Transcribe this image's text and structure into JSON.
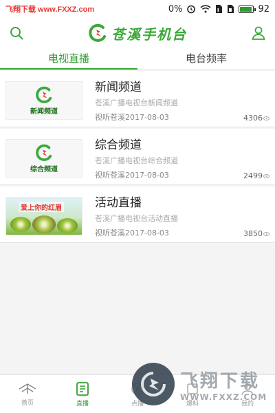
{
  "status_bar": {
    "watermark": "飞翔下载 www.FXXZ.com",
    "signal": "0%",
    "battery": "92",
    "battery_level": 0.92
  },
  "header": {
    "title": "苍溪手机台",
    "left_icon": "search-icon",
    "right_icon": "user-icon"
  },
  "tabs": [
    {
      "label": "电视直播",
      "active": true
    },
    {
      "label": "电台频率",
      "active": false
    }
  ],
  "channels": [
    {
      "thumb_label": "新闻频道",
      "title": "新闻频道",
      "desc": "苍溪广播电视台新闻频道",
      "source_date": "视听苍溪2017-08-03",
      "views": "4306"
    },
    {
      "thumb_label": "综合频道",
      "title": "综合频道",
      "desc": "苍溪广播电视台综合频道",
      "source_date": "视听苍溪2017-08-03",
      "views": "2499"
    },
    {
      "thumb_banner": "爱上你的红眉",
      "title": "活动直播",
      "desc": "苍溪广播电视台活动直播",
      "source_date": "视听苍溪2017-08-03",
      "views": "3850"
    }
  ],
  "bottom_nav": [
    {
      "label": "首页",
      "icon": "home-icon",
      "active": false
    },
    {
      "label": "直播",
      "icon": "live-icon",
      "active": true
    },
    {
      "label": "点播",
      "icon": "vod-icon",
      "active": false
    },
    {
      "label": "爆料",
      "icon": "report-icon",
      "active": false
    },
    {
      "label": "我的",
      "icon": "profile-icon",
      "active": false
    }
  ],
  "watermark": {
    "text": "飞翔下载",
    "url": "WWW.FXXZ.COM"
  },
  "colors": {
    "brand_green": "#3aa93a",
    "watermark_red": "#e53935"
  }
}
